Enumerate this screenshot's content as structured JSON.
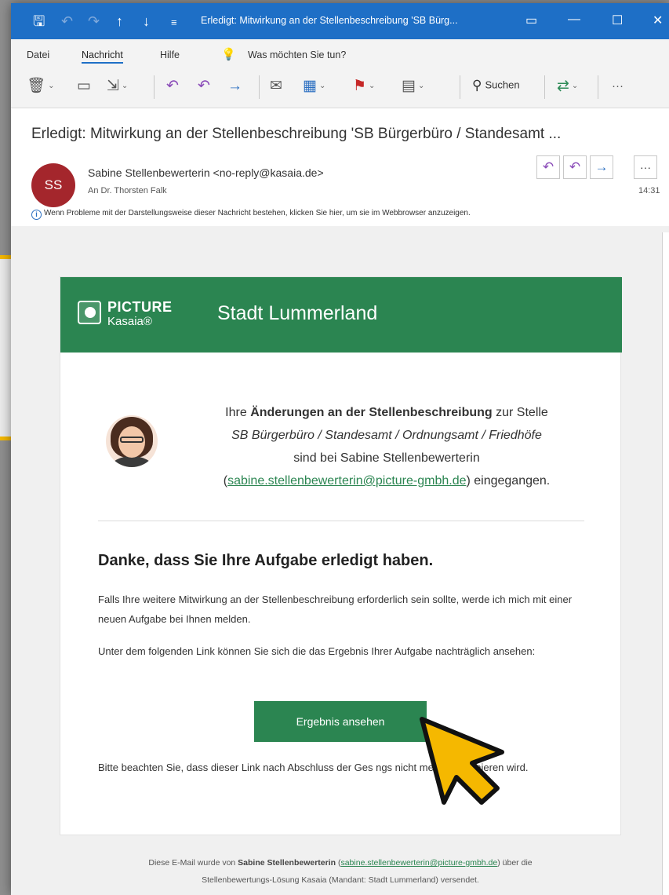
{
  "window": {
    "title": "Erledigt: Mitwirkung an der Stellenbeschreibung 'SB Bürg...",
    "title_icons": [
      "save-icon",
      "undo-icon",
      "redo-icon",
      "up-arrow-icon",
      "down-arrow-icon",
      "customize-icon"
    ],
    "controls": [
      "layout-icon",
      "minimize-icon",
      "maximize-icon",
      "close-icon"
    ]
  },
  "menu": {
    "items": [
      "Datei",
      "Nachricht",
      "Hilfe"
    ],
    "active": "Nachricht",
    "tell_me": "Was möchten Sie tun?"
  },
  "ribbon": {
    "search_label": "Suchen",
    "more_label": "···"
  },
  "message": {
    "subject": "Erledigt: Mitwirkung an der Stellenbeschreibung 'SB Bürgerbüro / Standesamt ...",
    "avatar_initials": "SS",
    "sender": "Sabine Stellenbewerterin <no-reply@kasaia.de>",
    "recipient": "An   Dr. Thorsten Falk",
    "time": "14:31",
    "info": "Wenn Probleme mit der Darstellungsweise dieser Nachricht bestehen, klicken Sie hier, um sie im Webbrowser anzuzeigen."
  },
  "email": {
    "logo_title": "PICTURE",
    "logo_sub": "Kasaia®",
    "header_title": "Stadt Lummerland",
    "intro_prefix": "Ihre ",
    "intro_bold": "Änderungen an der Stellenbeschreibung",
    "intro_mid": " zur Stelle",
    "intro_position": "SB Bürgerbüro / Standesamt / Ordnungsamt / Friedhöfe",
    "intro_received": "sind bei Sabine Stellenbewerterin",
    "intro_email": "sabine.stellenbewerterin@picture-gmbh.de",
    "intro_suffix": " eingegangen.",
    "heading": "Danke, dass Sie Ihre Aufgabe erledigt haben.",
    "para1": "Falls Ihre weitere Mitwirkung an der Stellenbeschreibung erforderlich sein sollte, werde ich mich mit einer neuen Aufgabe bei Ihnen melden.",
    "para2": "Unter dem folgenden Link können Sie sich die das Ergebnis Ihrer Aufgabe nachträglich ansehen:",
    "button": "Ergebnis ansehen",
    "para3": "Bitte beachten Sie, dass dieser Link nach Abschluss der Ges                    ngs nicht mehr funktionieren wird.",
    "footer_prefix": "Diese E-Mail wurde von ",
    "footer_name": "Sabine Stellenbewerterin",
    "footer_email": "sabine.stellenbewerterin@picture-gmbh.de",
    "footer_suffix": " über die",
    "footer_line2": "Stellenbewertungs-Lösung Kasaia (Mandant: Stadt Lummerland) versendet."
  },
  "colors": {
    "titlebar": "#1e6fc6",
    "brand_green": "#2b8551",
    "avatar": "#a4262c",
    "highlight": "#f5b800"
  }
}
